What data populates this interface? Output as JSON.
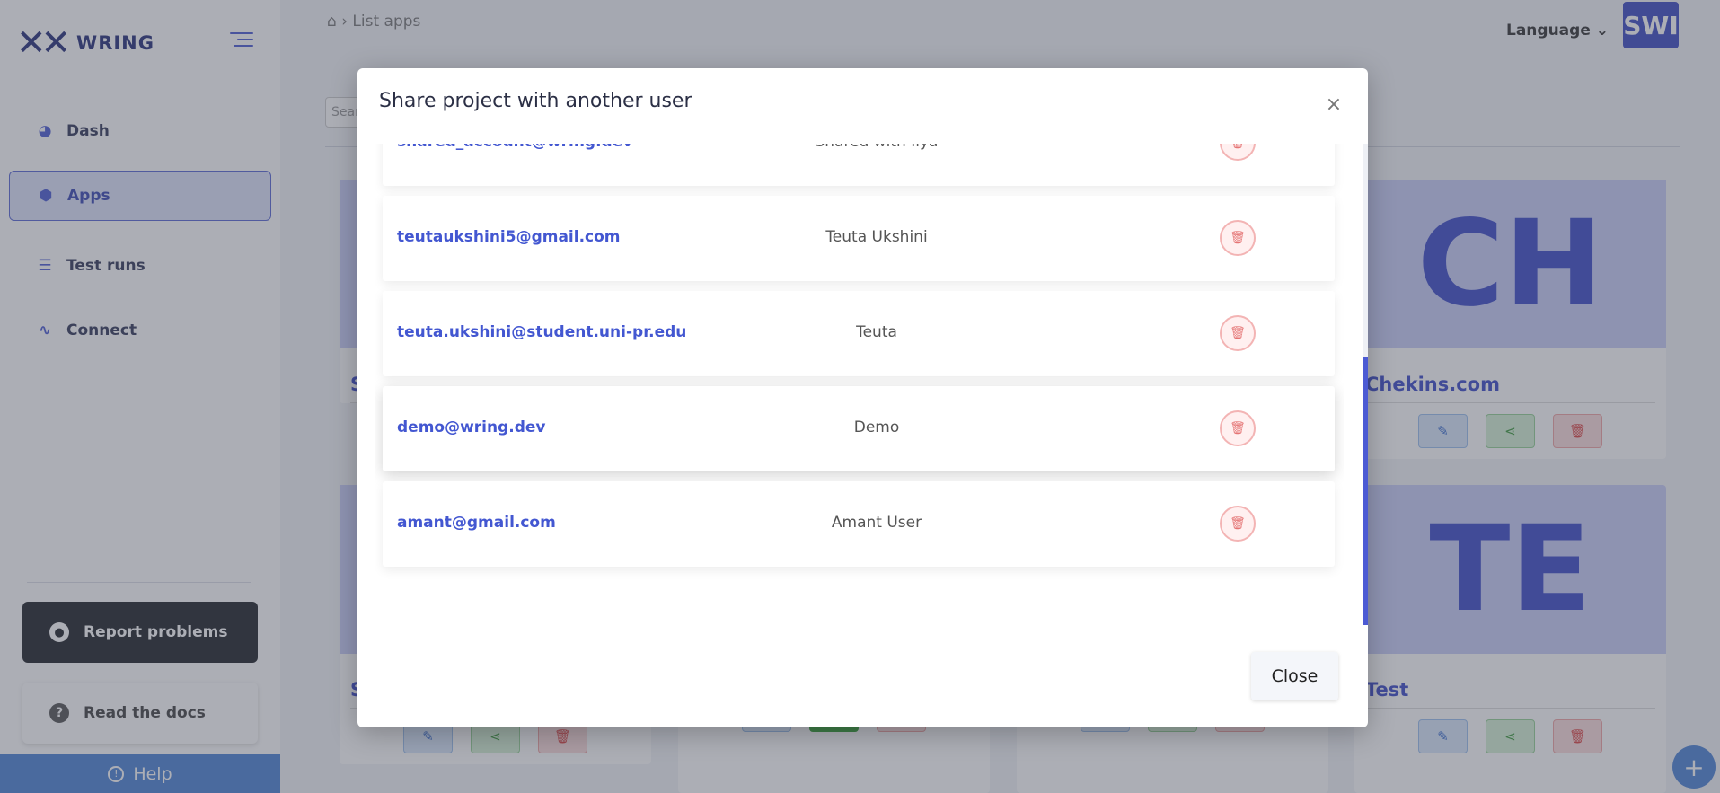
{
  "app": {
    "brand": "WRING",
    "logo_glyph": "✕✕"
  },
  "sidebar": {
    "items": [
      {
        "label": "Dash",
        "icon": "pie-chart-icon",
        "glyph": "◕"
      },
      {
        "label": "Apps",
        "icon": "cube-icon",
        "glyph": "⬢"
      },
      {
        "label": "Test runs",
        "icon": "list-icon",
        "glyph": "☰"
      },
      {
        "label": "Connect",
        "icon": "pulse-icon",
        "glyph": "∿"
      }
    ],
    "report_label": "Report problems",
    "docs_label": "Read the docs",
    "help_label": "Help"
  },
  "header": {
    "breadcrumb_current": "List apps",
    "language_label": "Language",
    "avatar_initials": "SWI",
    "search_placeholder": "Sear"
  },
  "cards": [
    {
      "initials": "",
      "title": "S"
    },
    {
      "initials": "CH",
      "title": "Chekins.com"
    },
    {
      "initials": "",
      "title": "S"
    },
    {
      "initials": "TE",
      "title": "Test"
    }
  ],
  "modal": {
    "title": "Share project with another user",
    "close_label": "Close",
    "rows": [
      {
        "email": "shared_account@wring.dev",
        "name": "Shared with Ilya"
      },
      {
        "email": "teutaukshini5@gmail.com",
        "name": "Teuta Ukshini"
      },
      {
        "email": "teuta.ukshini@student.uni-pr.edu",
        "name": "Teuta"
      },
      {
        "email": "demo@wring.dev",
        "name": "Demo"
      },
      {
        "email": "amant@gmail.com",
        "name": "Amant User"
      }
    ]
  },
  "colors": {
    "accent": "#4c5bd4",
    "brand": "#27307a",
    "danger": "#e57575",
    "overlay": "rgba(70,75,90,0.45)"
  }
}
